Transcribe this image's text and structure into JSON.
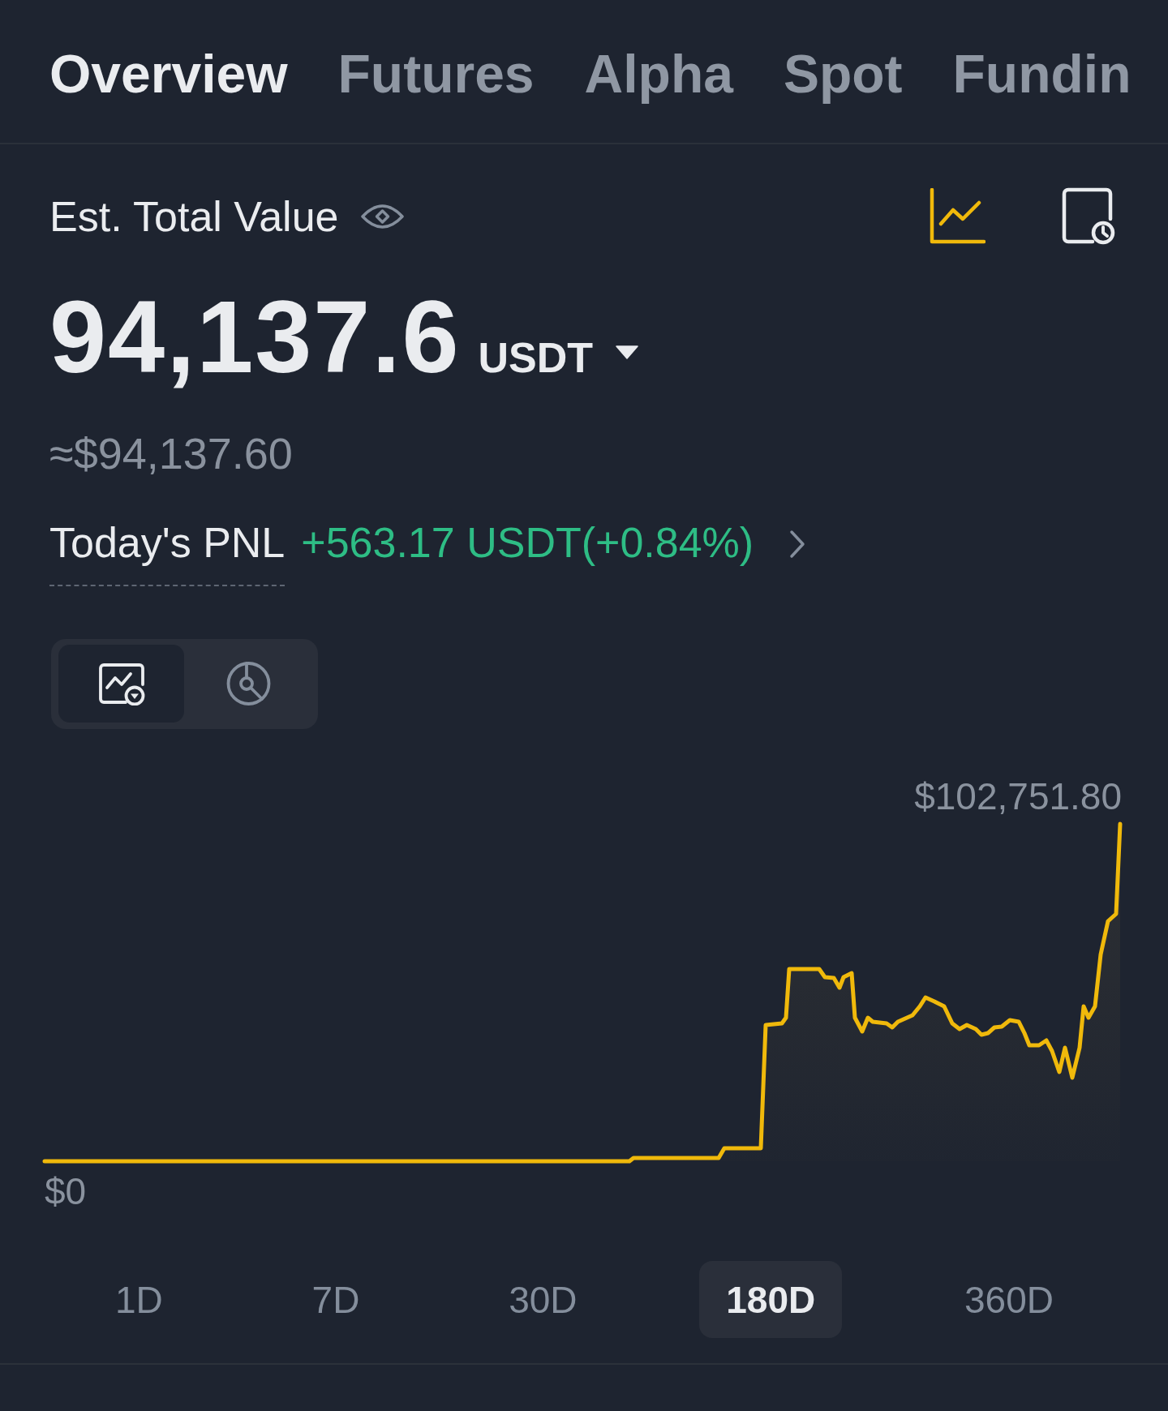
{
  "tabs": [
    {
      "label": "Overview",
      "selected": true
    },
    {
      "label": "Futures",
      "selected": false
    },
    {
      "label": "Alpha",
      "selected": false
    },
    {
      "label": "Spot",
      "selected": false
    },
    {
      "label": "Fundin",
      "selected": false
    }
  ],
  "balance": {
    "label": "Est. Total Value",
    "amount": "94,137.6",
    "currency": "USDT",
    "fiat_value": "≈$94,137.60"
  },
  "pnl": {
    "label": "Today's PNL",
    "value": "+563.17 USDT(+0.84%)"
  },
  "view_toggle": [
    {
      "kind": "chart",
      "selected": true
    },
    {
      "kind": "pie",
      "selected": false
    }
  ],
  "chart": {
    "max_label": "$102,751.80",
    "min_label": "$0"
  },
  "timeframes": [
    {
      "label": "1D",
      "selected": false
    },
    {
      "label": "7D",
      "selected": false
    },
    {
      "label": "30D",
      "selected": false
    },
    {
      "label": "180D",
      "selected": true
    },
    {
      "label": "360D",
      "selected": false
    }
  ]
}
